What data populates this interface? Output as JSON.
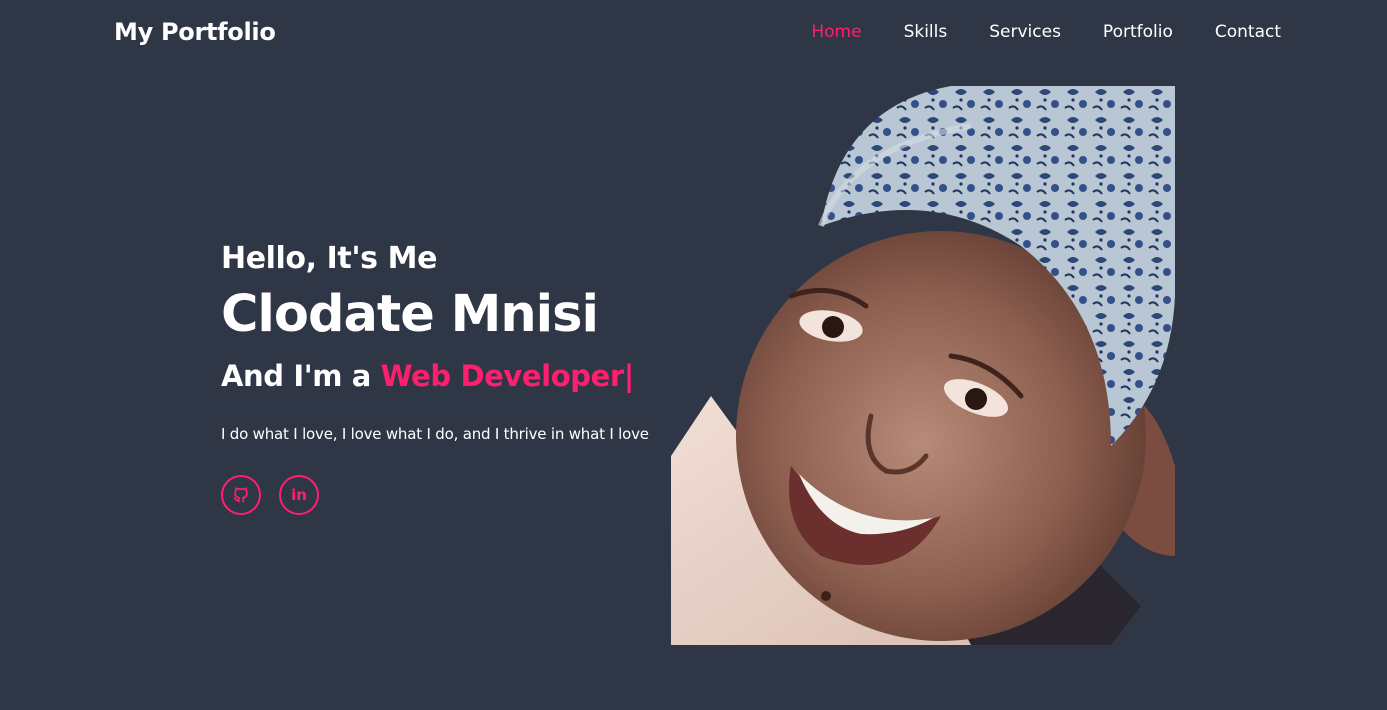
{
  "header": {
    "logo": "My Portfolio",
    "nav": [
      {
        "label": "Home",
        "active": true
      },
      {
        "label": "Skills",
        "active": false
      },
      {
        "label": "Services",
        "active": false
      },
      {
        "label": "Portfolio",
        "active": false
      },
      {
        "label": "Contact",
        "active": false
      }
    ]
  },
  "hero": {
    "greeting": "Hello, It's Me",
    "name": "Clodate Mnisi",
    "role_prefix": "And I'm a ",
    "role": "Web Developer",
    "caret": "|",
    "tagline": "I do what I love, I love what I do, and I thrive in what I love",
    "socials": [
      {
        "icon": "github-icon"
      },
      {
        "icon": "linkedin-icon",
        "glyph": "in"
      }
    ]
  },
  "colors": {
    "background": "#2f3645",
    "accent": "#ff1f6e",
    "text": "#ffffff"
  }
}
